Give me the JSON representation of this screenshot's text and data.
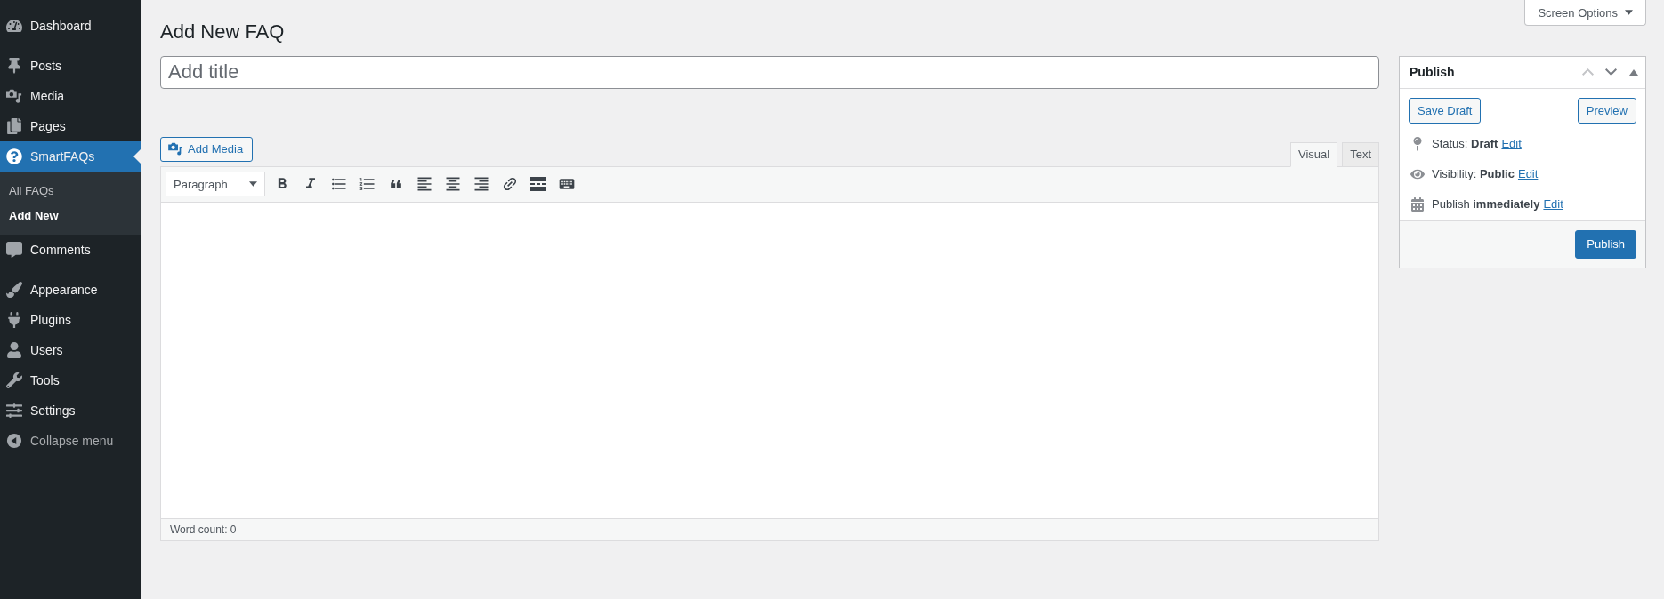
{
  "sidebar": {
    "menu_groups": [
      [
        {
          "label": "Dashboard",
          "selected": false
        }
      ],
      [
        {
          "label": "Posts",
          "selected": false
        },
        {
          "label": "Media",
          "selected": false
        },
        {
          "label": "Pages",
          "selected": false
        },
        {
          "label": "SmartFAQs",
          "selected": true,
          "children": [
            {
              "label": "All FAQs",
              "selected": false
            },
            {
              "label": "Add New",
              "selected": true
            }
          ]
        },
        {
          "label": "Comments",
          "selected": false
        }
      ],
      [
        {
          "label": "Appearance",
          "selected": false
        },
        {
          "label": "Plugins",
          "selected": false
        },
        {
          "label": "Users",
          "selected": false
        },
        {
          "label": "Tools",
          "selected": false
        },
        {
          "label": "Settings",
          "selected": false
        }
      ]
    ],
    "collapse_button": "Collapse menu"
  },
  "screen_options": "Screen Options",
  "page_title": "Add New FAQ",
  "title_field": {
    "placeholder": "Add title"
  },
  "add_media_button": "Add Media",
  "editor_tabs": [
    {
      "label": "Visual",
      "selected": true
    },
    {
      "label": "Text",
      "selected": false
    }
  ],
  "editor_toolbar": {
    "format_select": "Paragraph"
  },
  "word_count": "Word count: 0",
  "publish_box": {
    "title": "Publish",
    "move_up": {
      "disabled": true
    },
    "move_down": {
      "disabled": false
    },
    "expanded": true,
    "save_draft_button": "Save Draft",
    "preview_button": "Preview",
    "meta": [
      {
        "text": "Status: **Draft**",
        "link": "Edit"
      },
      {
        "text": "Visibility: **Public**",
        "link": "Edit"
      },
      {
        "text": "Publish **immediately**",
        "link": "Edit"
      }
    ],
    "publish_button": "Publish"
  }
}
